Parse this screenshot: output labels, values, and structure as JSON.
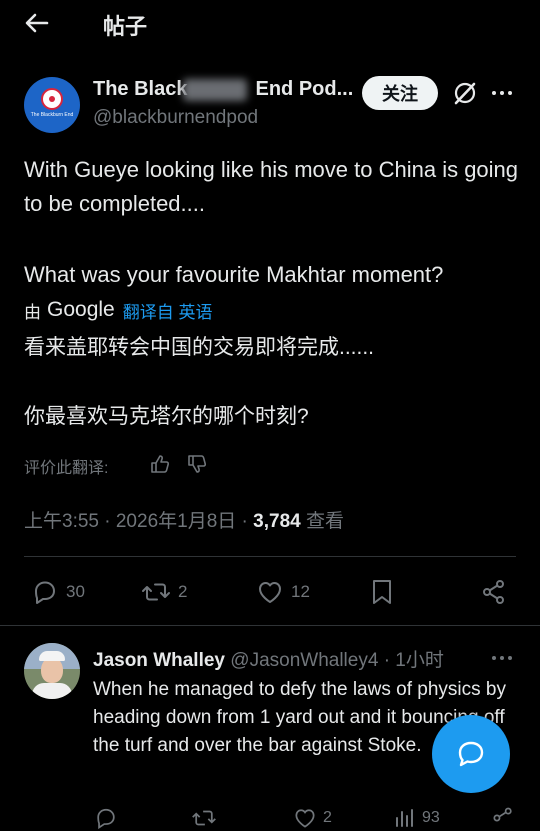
{
  "header": {
    "title": "帖子"
  },
  "post": {
    "avatar_text": "The Blackburn End",
    "display_name": "The Black",
    "display_name_tail": "End Pod...",
    "handle": "@blackburnendpod",
    "follow_label": "关注",
    "text_line1": "With Gueye looking like his move to China is going to be completed....",
    "text_line2": "What was your favourite Makhtar moment?",
    "translation_prefix": "由",
    "translation_brand": "Google",
    "translation_link": "翻译自 英语",
    "translated_line1": "看来盖耶转会中国的交易即将完成......",
    "translated_line2": "你最喜欢马克塔尔的哪个时刻?",
    "rate_label": "评价此翻译:",
    "timestamp": "上午3:55 · 2026年1月8日 · ",
    "views_count": "3,784",
    "views_label": " 查看",
    "replies": "30",
    "reposts": "2",
    "likes": "12"
  },
  "reply": {
    "name": "Jason Whalley",
    "handle_time": " @JasonWhalley4 · 1小时",
    "text": "When he managed to defy the laws of physics by heading down from 1 yard out and it bouncing off the turf and over the bar against Stoke.",
    "likes": "2",
    "views": "93"
  },
  "colors": {
    "accent": "#1d9bf0",
    "background": "#000000",
    "muted": "#71767b"
  }
}
